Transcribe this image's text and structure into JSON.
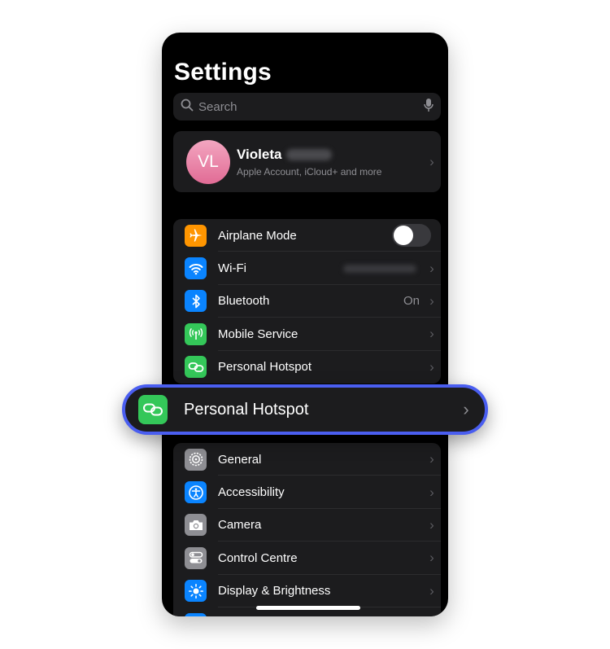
{
  "header": {
    "title": "Settings"
  },
  "search": {
    "placeholder": "Search",
    "icon": "magnifier-icon",
    "mic_icon": "microphone-icon"
  },
  "account": {
    "initials": "VL",
    "name": "Violeta",
    "subtitle": "Apple Account, iCloud+ and more",
    "avatar_colors": [
      "#f3a6c0",
      "#e16b95"
    ]
  },
  "group1": [
    {
      "label": "Airplane Mode",
      "icon": "airplane-icon",
      "color": "#ff9500",
      "control": "toggle",
      "toggle_on": false
    },
    {
      "label": "Wi-Fi",
      "icon": "wifi-icon",
      "color": "#0a84ff",
      "control": "blurred-value"
    },
    {
      "label": "Bluetooth",
      "icon": "bluetooth-icon",
      "color": "#0a84ff",
      "value": "On"
    },
    {
      "label": "Mobile Service",
      "icon": "antenna-icon",
      "color": "#34c759"
    },
    {
      "label": "Personal Hotspot",
      "icon": "link-icon",
      "color": "#34c759"
    }
  ],
  "highlight": {
    "label": "Personal Hotspot",
    "icon": "link-icon",
    "color": "#34c759",
    "border_color": "#4a5ef0"
  },
  "group2": [
    {
      "label": "General",
      "icon": "gear-icon",
      "color": "#8e8e93"
    },
    {
      "label": "Accessibility",
      "icon": "accessibility-icon",
      "color": "#0a84ff"
    },
    {
      "label": "Camera",
      "icon": "camera-icon",
      "color": "#8e8e93"
    },
    {
      "label": "Control Centre",
      "icon": "switches-icon",
      "color": "#8e8e93"
    },
    {
      "label": "Display & Brightness",
      "icon": "sun-icon",
      "color": "#0a84ff"
    }
  ]
}
